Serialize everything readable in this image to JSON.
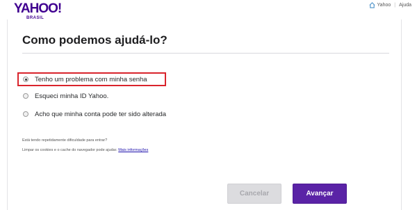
{
  "header": {
    "logo_text": "YAHOO!",
    "logo_region": "BRASIL",
    "nav_home": "Yahoo",
    "nav_separator": "|",
    "nav_help": "Ajuda"
  },
  "page": {
    "title": "Como podemos ajudá-lo?"
  },
  "options": [
    {
      "label": "Tenho um problema com minha senha",
      "selected": true
    },
    {
      "label": "Esqueci minha ID Yahoo.",
      "selected": false
    },
    {
      "label": "Acho que minha conta pode ter sido alterada",
      "selected": false
    }
  ],
  "help": {
    "line1": "Está tendo repetidamente dificuldade para entrar?",
    "line2": "Limpar os cookies e o cache do navegador pode ajudar.",
    "link": "Mais informações"
  },
  "buttons": {
    "cancel": "Cancelar",
    "next": "Avançar"
  },
  "colors": {
    "brand": "#400090",
    "primary_button": "#5a23a6",
    "highlight_border": "#d9242c"
  }
}
